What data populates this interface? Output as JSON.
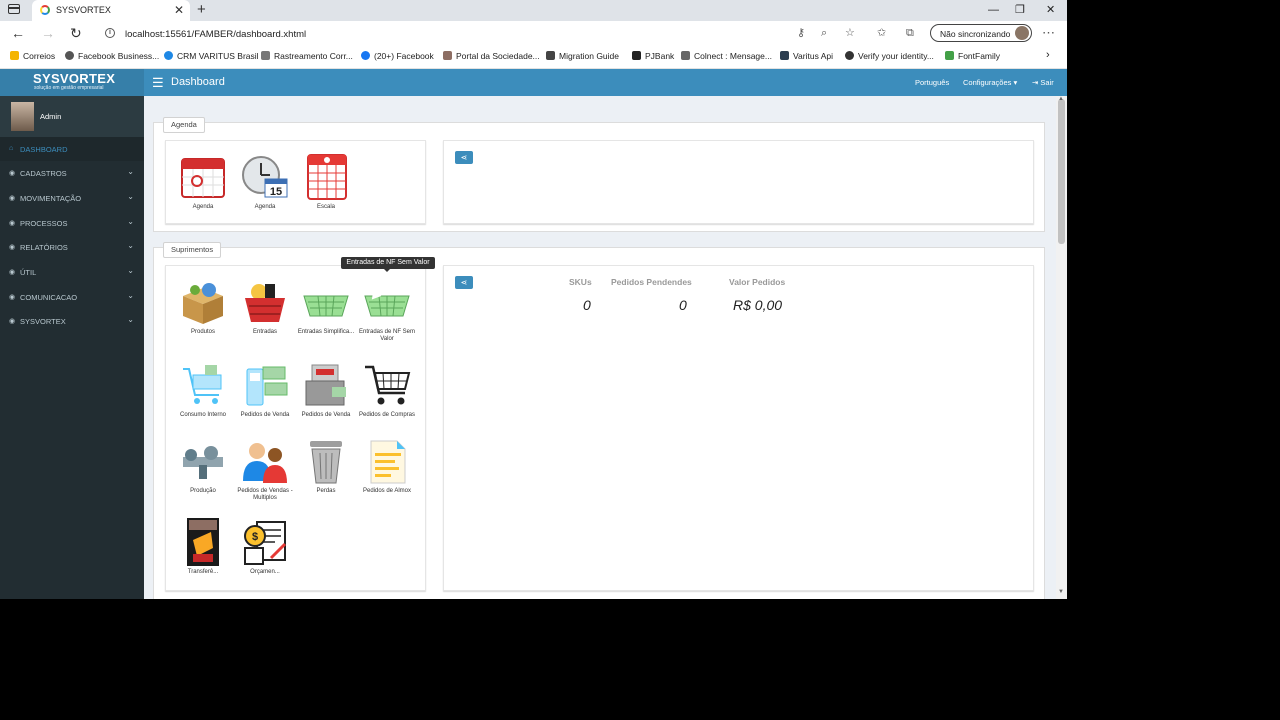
{
  "browser": {
    "tab_title": "SYSVORTEX",
    "tab_close": "✕",
    "new_tab": "+",
    "url": "localhost:15561/FAMBER/dashboard.xhtml",
    "sync_label": "Não sincronizando",
    "window_controls": {
      "minimize": "—",
      "restore": "❐",
      "close": "✕"
    },
    "nav": {
      "back": "←",
      "forward": "→",
      "reload": "↻",
      "more": "⋯"
    },
    "bookmarks": [
      {
        "label": "Correios",
        "color": "#f4b400"
      },
      {
        "label": "Facebook Business...",
        "color": "#555555"
      },
      {
        "label": "CRM VARITUS Brasil",
        "color": "#1e88e5"
      },
      {
        "label": "Rastreamento Corr...",
        "color": "#777777"
      },
      {
        "label": "(20+) Facebook",
        "color": "#1877f2"
      },
      {
        "label": "Portal da Sociedade...",
        "color": "#8d6e63"
      },
      {
        "label": "Migration Guide",
        "color": "#444444"
      },
      {
        "label": "PJBank",
        "color": "#222222"
      },
      {
        "label": "Colnect : Mensage...",
        "color": "#666666"
      },
      {
        "label": "Varitus Api",
        "color": "#2c3e50"
      },
      {
        "label": "Verify your identity...",
        "color": "#333333"
      },
      {
        "label": "FontFamily",
        "color": "#43a047"
      }
    ]
  },
  "app": {
    "logo": "SYSVORTEX",
    "logo_sub": "solução em gestão empresarial",
    "page_title": "Dashboard",
    "top_links": {
      "language": "Português",
      "settings": "Configurações ▾",
      "logout": "⇥ Sair"
    },
    "user": {
      "name": "Admin"
    },
    "menu": [
      {
        "label": "DASHBOARD",
        "active": true,
        "chevron": ""
      },
      {
        "label": "CADASTROS",
        "chevron": "⌄"
      },
      {
        "label": "MOVIMENTAÇÃO",
        "chevron": "⌄"
      },
      {
        "label": "PROCESSOS",
        "chevron": "⌄"
      },
      {
        "label": "RELATÓRIOS",
        "chevron": "⌄"
      },
      {
        "label": "ÚTIL",
        "chevron": "⌄"
      },
      {
        "label": "COMUNICACAO",
        "chevron": "⌄"
      },
      {
        "label": "SYSVORTEX",
        "chevron": "⌄"
      }
    ]
  },
  "agenda": {
    "legend": "Agenda",
    "items": [
      "Agenda",
      "Agenda",
      "Escala"
    ]
  },
  "suprimentos": {
    "legend": "Suprimentos",
    "tooltip": "Entradas de NF Sem Valor",
    "items": [
      "Produtos",
      "Entradas",
      "Entradas Simplifica...",
      "Entradas de NF Sem Valor",
      "Consumo Interno",
      "Pedidos de Venda",
      "Pedidos de Venda",
      "Pedidos de Compras",
      "Produção",
      "Pedidos de Vendas - Multiplos",
      "Perdas",
      "Pedidos de Almox",
      "Transferê...",
      "Orçamen..."
    ],
    "stats": {
      "skus_label": "SKUs",
      "skus_value": "0",
      "pending_label": "Pedidos Pendendes",
      "pending_value": "0",
      "value_label": "Valor Pedidos",
      "value_value": "R$ 0,00"
    }
  },
  "share_icon": "share-icon",
  "colors": {
    "primary": "#3c8dbc",
    "sidebar": "#222d32",
    "content_bg": "#ecf0f5"
  }
}
